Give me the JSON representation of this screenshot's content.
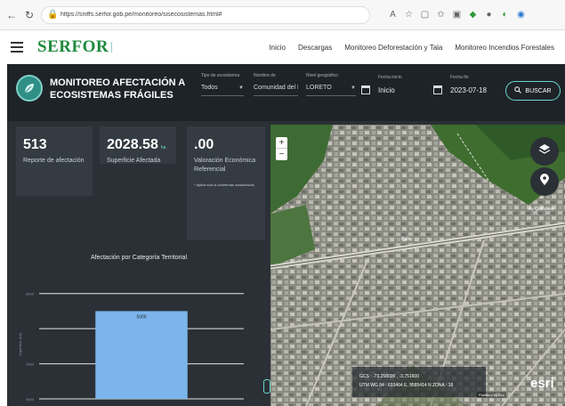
{
  "browser": {
    "url": "https://sniffs.serfor.gob.pe/monitoreo/sisecosistemas.html#"
  },
  "site": {
    "logo": "SERFOR",
    "nav": [
      "Inicio",
      "Descargas",
      "Monitoreo Deforestación y Tala",
      "Monitoreo Incendios Forestales"
    ]
  },
  "app": {
    "title": "MONITOREO AFECTACIÓN A ECOSISTEMAS FRÁGILES",
    "filters": {
      "tipo": {
        "label": "Tipo de ecosistema",
        "value": "Todos"
      },
      "nombre": {
        "label": "Nombre de",
        "value": "Comunidad del Li"
      },
      "nivel": {
        "label": "Nivel geográfico",
        "value": "LORETO"
      },
      "fecha_inicio": {
        "label": "Fecha inicio",
        "value": "Inicio"
      },
      "fecha_fin": {
        "label": "Fecha fin",
        "value": "2023-07-18"
      }
    },
    "search_label": "BUSCAR",
    "stats": {
      "reportes": {
        "value": "513",
        "label": "Reporte de afectación"
      },
      "superficie": {
        "value": "2028.58",
        "unit": "ha",
        "label": "Superficie Afectada"
      },
      "valoracion": {
        "value": ".00",
        "label": "Valoración Económica Referencial",
        "note": "* Aplica solo a coberturas amazónicas"
      }
    }
  },
  "chart_data": {
    "type": "bar",
    "title": "Afectación por Categoría Territorial",
    "categories": [
      ""
    ],
    "values": [
      5000
    ],
    "data_labels": [
      "5000"
    ],
    "ylim": [
      0,
      7000
    ],
    "yticks": [
      0,
      2000,
      4000,
      6000
    ],
    "ytick_labels": [
      "5000",
      "2000",
      "",
      "6000"
    ],
    "ylabel": "Superficie (ha)",
    "grid": true,
    "bar_color": "#7cb5ec"
  },
  "map": {
    "scale_line1": "GCS : -73.258000 , -3.751600",
    "scale_line2": "UTM WG 84 : 693464 E, 9585414 N ZONA : 18",
    "attribution": "Powered by Esri",
    "esri_logo": "esri",
    "street_labels": [
      "Calle",
      "Av Quiñones"
    ]
  },
  "colors": {
    "accent": "#6ad9cf",
    "brand_green": "#1f8a3d",
    "panel_bg": "#2b3036"
  }
}
